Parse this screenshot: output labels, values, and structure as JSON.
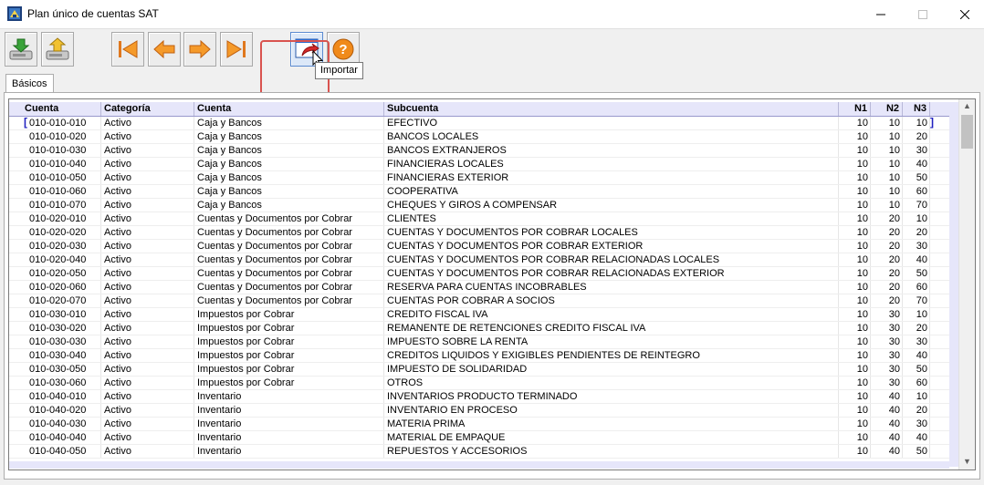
{
  "window": {
    "title": "Plan único de cuentas SAT"
  },
  "toolbar": {
    "tooltip": "Importar",
    "buttons": [
      {
        "name": "save-button",
        "icon": "disk-download-icon"
      },
      {
        "name": "upload-button",
        "icon": "disk-upload-icon"
      },
      {
        "name": "first-record-button",
        "icon": "first-icon"
      },
      {
        "name": "previous-record-button",
        "icon": "arrow-left-icon"
      },
      {
        "name": "next-record-button",
        "icon": "arrow-right-icon"
      },
      {
        "name": "last-record-button",
        "icon": "last-icon"
      },
      {
        "name": "import-button",
        "icon": "import-window-icon"
      },
      {
        "name": "help-button",
        "icon": "question-icon"
      }
    ]
  },
  "tabs": {
    "active": "Básicos"
  },
  "grid": {
    "columns": [
      "Cuenta",
      "Categoría",
      "Cuenta",
      "Subcuenta",
      "N1",
      "N2",
      "N3"
    ],
    "rows": [
      [
        "010-010-010",
        "Activo",
        "Caja y Bancos",
        "EFECTIVO",
        "10",
        "10",
        "10"
      ],
      [
        "010-010-020",
        "Activo",
        "Caja y Bancos",
        "BANCOS LOCALES",
        "10",
        "10",
        "20"
      ],
      [
        "010-010-030",
        "Activo",
        "Caja y Bancos",
        "BANCOS EXTRANJEROS",
        "10",
        "10",
        "30"
      ],
      [
        "010-010-040",
        "Activo",
        "Caja y Bancos",
        "FINANCIERAS LOCALES",
        "10",
        "10",
        "40"
      ],
      [
        "010-010-050",
        "Activo",
        "Caja y Bancos",
        "FINANCIERAS EXTERIOR",
        "10",
        "10",
        "50"
      ],
      [
        "010-010-060",
        "Activo",
        "Caja y Bancos",
        "COOPERATIVA",
        "10",
        "10",
        "60"
      ],
      [
        "010-010-070",
        "Activo",
        "Caja y Bancos",
        "CHEQUES Y GIROS A COMPENSAR",
        "10",
        "10",
        "70"
      ],
      [
        "010-020-010",
        "Activo",
        "Cuentas y Documentos por Cobrar",
        "CLIENTES",
        "10",
        "20",
        "10"
      ],
      [
        "010-020-020",
        "Activo",
        "Cuentas y Documentos por Cobrar",
        "CUENTAS Y DOCUMENTOS POR COBRAR LOCALES",
        "10",
        "20",
        "20"
      ],
      [
        "010-020-030",
        "Activo",
        "Cuentas y Documentos por Cobrar",
        "CUENTAS Y DOCUMENTOS POR COBRAR EXTERIOR",
        "10",
        "20",
        "30"
      ],
      [
        "010-020-040",
        "Activo",
        "Cuentas y Documentos por Cobrar",
        "CUENTAS Y DOCUMENTOS POR COBRAR RELACIONADAS LOCALES",
        "10",
        "20",
        "40"
      ],
      [
        "010-020-050",
        "Activo",
        "Cuentas y Documentos por Cobrar",
        "CUENTAS Y DOCUMENTOS POR COBRAR RELACIONADAS EXTERIOR",
        "10",
        "20",
        "50"
      ],
      [
        "010-020-060",
        "Activo",
        "Cuentas y Documentos por Cobrar",
        "RESERVA PARA CUENTAS INCOBRABLES",
        "10",
        "20",
        "60"
      ],
      [
        "010-020-070",
        "Activo",
        "Cuentas y Documentos por Cobrar",
        "CUENTAS POR COBRAR A SOCIOS",
        "10",
        "20",
        "70"
      ],
      [
        "010-030-010",
        "Activo",
        "Impuestos por Cobrar",
        "CREDITO FISCAL IVA",
        "10",
        "30",
        "10"
      ],
      [
        "010-030-020",
        "Activo",
        "Impuestos por Cobrar",
        "REMANENTE DE RETENCIONES CREDITO FISCAL IVA",
        "10",
        "30",
        "20"
      ],
      [
        "010-030-030",
        "Activo",
        "Impuestos por Cobrar",
        "IMPUESTO SOBRE LA RENTA",
        "10",
        "30",
        "30"
      ],
      [
        "010-030-040",
        "Activo",
        "Impuestos por Cobrar",
        "CREDITOS LIQUIDOS Y EXIGIBLES PENDIENTES DE REINTEGRO",
        "10",
        "30",
        "40"
      ],
      [
        "010-030-050",
        "Activo",
        "Impuestos por Cobrar",
        "IMPUESTO DE SOLIDARIDAD",
        "10",
        "30",
        "50"
      ],
      [
        "010-030-060",
        "Activo",
        "Impuestos por Cobrar",
        "OTROS",
        "10",
        "30",
        "60"
      ],
      [
        "010-040-010",
        "Activo",
        "Inventario",
        "INVENTARIOS PRODUCTO TERMINADO",
        "10",
        "40",
        "10"
      ],
      [
        "010-040-020",
        "Activo",
        "Inventario",
        "INVENTARIO EN PROCESO",
        "10",
        "40",
        "20"
      ],
      [
        "010-040-030",
        "Activo",
        "Inventario",
        "MATERIA PRIMA",
        "10",
        "40",
        "30"
      ],
      [
        "010-040-040",
        "Activo",
        "Inventario",
        "MATERIAL DE EMPAQUE",
        "10",
        "40",
        "40"
      ],
      [
        "010-040-050",
        "Activo",
        "Inventario",
        "REPUESTOS Y ACCESORIOS",
        "10",
        "40",
        "50"
      ]
    ]
  }
}
